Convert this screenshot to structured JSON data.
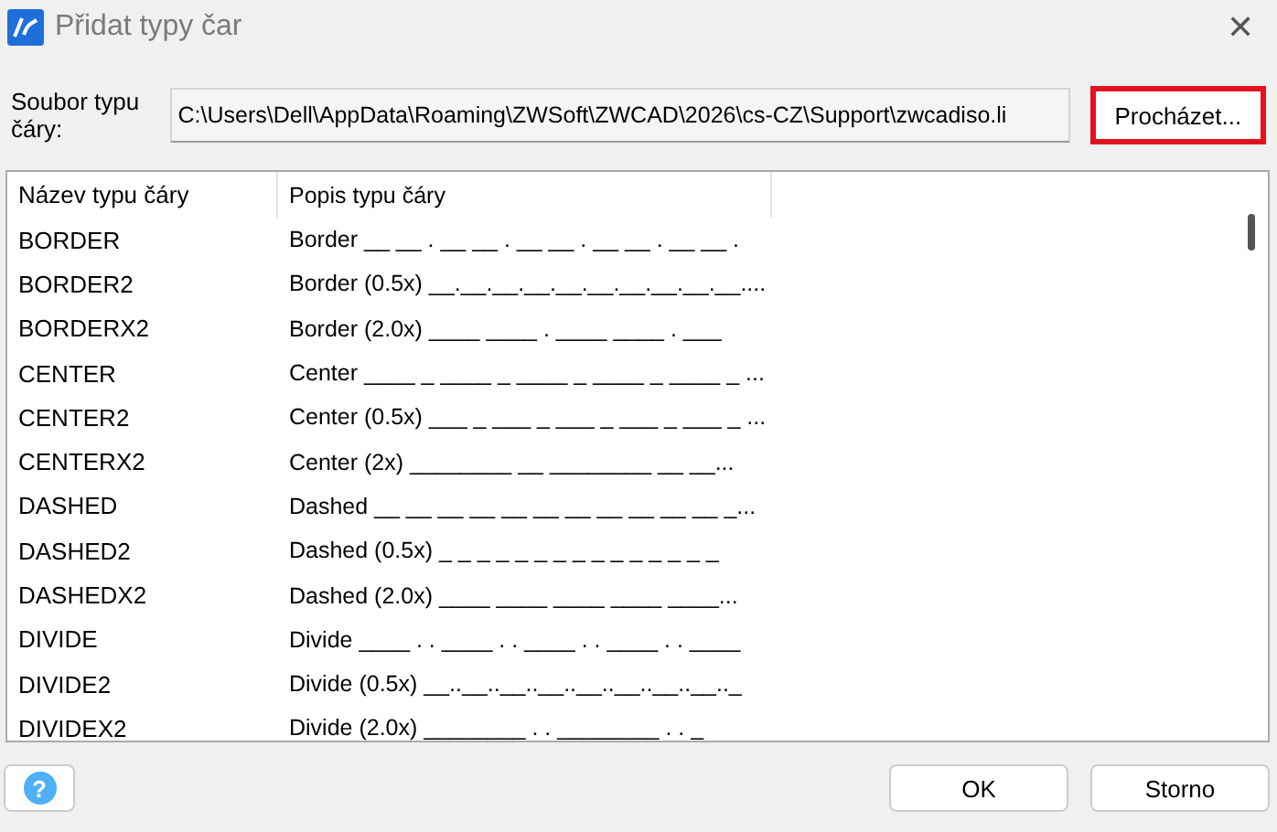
{
  "window": {
    "title": "Přidat typy čar",
    "close": "✕"
  },
  "file": {
    "label": "Soubor typu čáry:",
    "value": "C:\\Users\\Dell\\AppData\\Roaming\\ZWSoft\\ZWCAD\\2026\\cs-CZ\\Support\\zwcadiso.li",
    "browse": "Procházet..."
  },
  "table": {
    "columns": [
      "Název typu čáry",
      "Popis typu čáry"
    ],
    "rows": [
      [
        "BORDER",
        "Border __ __ . __ __ . __ __ . __ __ . __ __ ."
      ],
      [
        "BORDER2",
        "Border (0.5x) __.__.__.__.__.__.__.__.__.__...."
      ],
      [
        "BORDERX2",
        "Border (2.0x) ____  ____  .  ____  ____  .  ___"
      ],
      [
        "CENTER",
        "Center ____ _ ____ _ ____ _ ____ _ ____ _ ..."
      ],
      [
        "CENTER2",
        "Center (0.5x) ___ _ ___ _ ___ _ ___ _ ___ _ ..."
      ],
      [
        "CENTERX2",
        "Center (2x) ________  __  ________  __  __..."
      ],
      [
        "DASHED",
        "Dashed __ __ __ __ __ __ __ __ __ __ __ _..."
      ],
      [
        "DASHED2",
        "Dashed (0.5x) _ _ _ _ _ _ _ _ _ _ _ _ _ _ _"
      ],
      [
        "DASHEDX2",
        "Dashed (2.0x) ____  ____  ____  ____  ____..."
      ],
      [
        "DIVIDE",
        "Divide ____ . . ____ . . ____ . . ____ . . ____"
      ],
      [
        "DIVIDE2",
        "Divide (0.5x) __..__..__..__..__..__..__..__.._"
      ],
      [
        "DIVIDEX2",
        "Divide (2.0x) ________  . .  ________  . .  _"
      ]
    ]
  },
  "help_icon": "?",
  "buttons": [
    "OK",
    "Storno"
  ]
}
